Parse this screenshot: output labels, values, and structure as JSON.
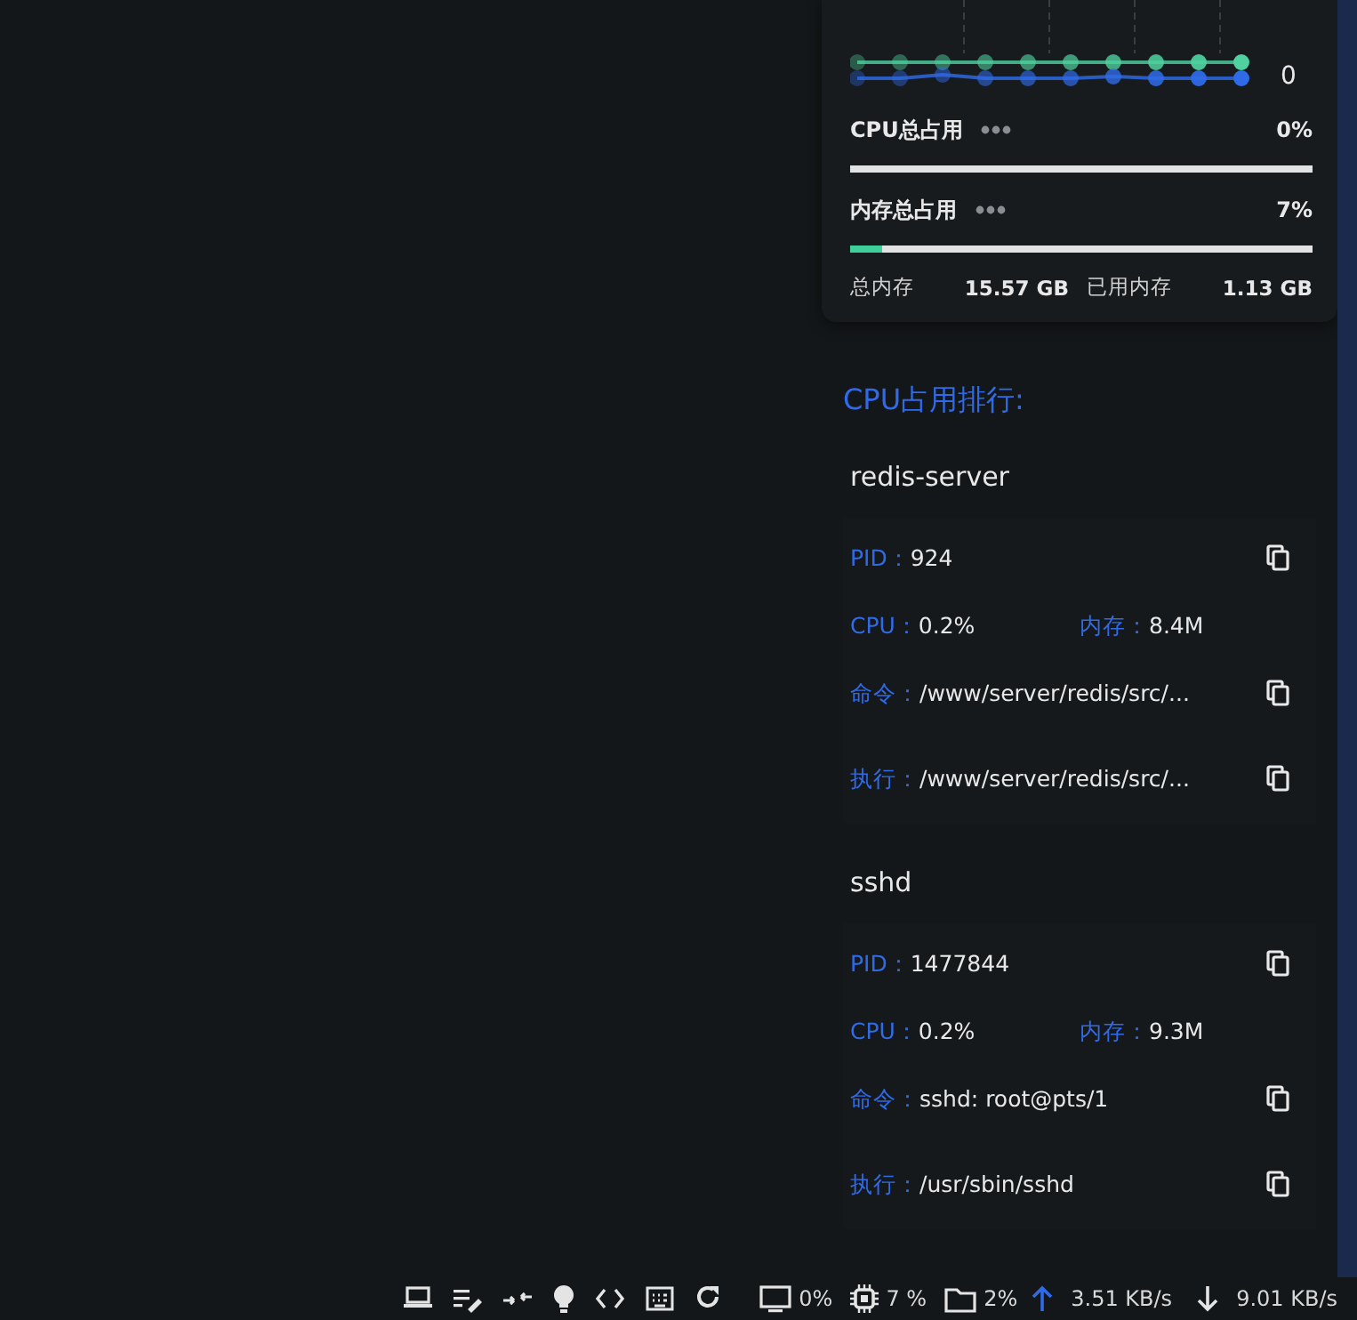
{
  "summary": {
    "chart_label": "0",
    "meters": [
      {
        "label": "CPU总占用",
        "value": "0%",
        "level": 0
      },
      {
        "label": "内存总占用",
        "value": "7%",
        "level": 0.07
      }
    ],
    "details": [
      {
        "label": "总内存",
        "value": "15.57 GB"
      },
      {
        "label": "已用内存",
        "value": "1.13 GB"
      }
    ]
  },
  "ranking": {
    "title": "CPU占用排行:",
    "processes": [
      {
        "name": "redis-server",
        "rows": [
          {
            "kind": "copyable",
            "fields": [
              {
                "label": "PID：",
                "value": "924"
              }
            ]
          },
          {
            "kind": "plain",
            "fields": [
              {
                "label": "CPU：",
                "value": "0.2%"
              },
              {
                "label": "内存：",
                "value": "8.4M"
              }
            ]
          },
          {
            "kind": "copyable",
            "fields": [
              {
                "label": "命令：",
                "value": "/www/server/redis/src/..."
              }
            ]
          },
          {
            "kind": "copyable",
            "fields": [
              {
                "label": "执行：",
                "value": "/www/server/redis/src/..."
              }
            ]
          }
        ]
      },
      {
        "name": "sshd",
        "rows": [
          {
            "kind": "copyable",
            "fields": [
              {
                "label": "PID：",
                "value": "1477844"
              }
            ]
          },
          {
            "kind": "plain",
            "fields": [
              {
                "label": "CPU：",
                "value": "0.2%"
              },
              {
                "label": "内存：",
                "value": "9.3M"
              }
            ]
          },
          {
            "kind": "copyable",
            "fields": [
              {
                "label": "命令：",
                "value": "sshd: root@pts/1"
              }
            ]
          },
          {
            "kind": "copyable",
            "fields": [
              {
                "label": "执行：",
                "value": "/usr/sbin/sshd"
              }
            ]
          }
        ]
      }
    ]
  },
  "status_bar": {
    "readings": [
      {
        "text": "0%"
      },
      {
        "text": "7 %"
      },
      {
        "text": "2%"
      },
      {
        "text": "3.51 KB/s"
      },
      {
        "text": "9.01 KB/s"
      }
    ]
  }
}
